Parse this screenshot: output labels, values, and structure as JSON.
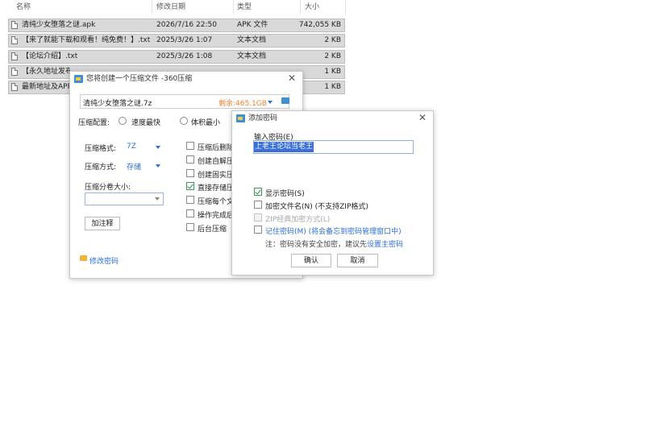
{
  "file_list": {
    "columns": [
      "名称",
      "修改日期",
      "类型",
      "大小"
    ],
    "rows": [
      {
        "name": "清纯少女堕落之谜.apk",
        "date": "2026/7/16 22:50",
        "type": "APK 文件",
        "size": "742,055 KB"
      },
      {
        "name": "【来了就能下载和观看！纯免费！】.txt",
        "date": "2025/3/26 1:07",
        "type": "文本文档",
        "size": "2 KB"
      },
      {
        "name": "【论坛介绍】.txt",
        "date": "2025/3/26 1:08",
        "type": "文本文档",
        "size": "2 KB"
      },
      {
        "name": "【永久地址发布",
        "date": "",
        "type": "",
        "size": "1 KB"
      },
      {
        "name": "最新地址及APP",
        "date": "",
        "type": "",
        "size": "1 KB"
      }
    ]
  },
  "compress_dialog": {
    "title": "您将创建一个压缩文件 -360压缩",
    "archive_name": "清纯少女堕落之谜.7z",
    "free_space": "剩余:465.1GB",
    "config_label": "压缩配置:",
    "options": [
      "速度最快",
      "体积最小"
    ],
    "format_label": "压缩格式:",
    "format_value": "7Z",
    "method_label": "压缩方式:",
    "method_value": "存储",
    "split_label": "压缩分卷大小:",
    "comment_button": "加注释",
    "change_password_link": "修改密码",
    "checkboxes": [
      {
        "label": "压缩后删除",
        "checked": false
      },
      {
        "label": "创建自解压",
        "checked": false
      },
      {
        "label": "创建固实压",
        "checked": false
      },
      {
        "label": "直接存储压",
        "checked": true
      },
      {
        "label": "压缩每个文",
        "checked": false
      },
      {
        "label": "操作完成后",
        "checked": false
      },
      {
        "label": "后台压缩",
        "checked": false
      }
    ]
  },
  "password_dialog": {
    "title": "添加密码",
    "input_label": "输入密码(E)",
    "password_value": "上老王论坛当老王",
    "show_password": {
      "label": "显示密码(S)",
      "checked": true
    },
    "encrypt_names": {
      "label": "加密文件名(N) (不支持ZIP格式)",
      "checked": false
    },
    "zip_classic": {
      "label": "ZIP经典加密方式(L)",
      "checked": false
    },
    "remember": {
      "label": "记住密码(M) (将会备忘到密码管理窗口中)",
      "checked": false
    },
    "note_prefix": "注：密码没有安全加密，建议先",
    "note_link": "设置主密码",
    "ok_button": "确认",
    "cancel_button": "取消"
  },
  "colors": {
    "accent": "#2a6fd6",
    "warning": "#e8822f",
    "selection": "#3a6ed8"
  }
}
